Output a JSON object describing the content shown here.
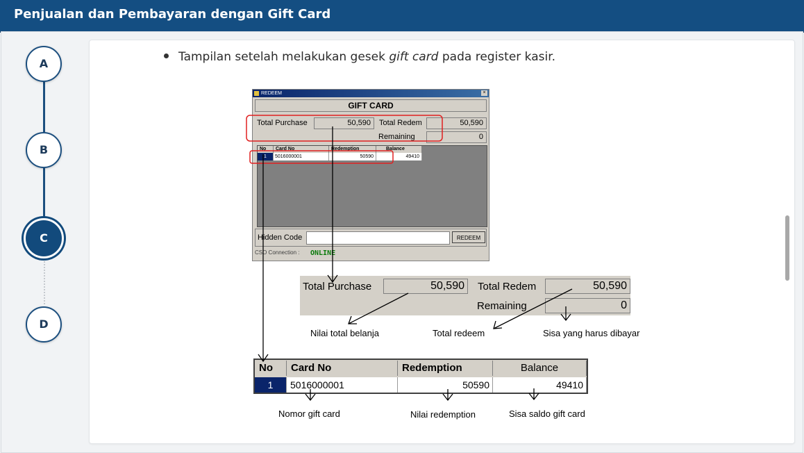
{
  "header": {
    "title": "Penjualan dan Pembayaran dengan Gift Card"
  },
  "steps": [
    "A",
    "B",
    "C",
    "D"
  ],
  "active_step": "C",
  "content": {
    "bullet_before": "Tampilan setelah melakukan gesek ",
    "bullet_italic": "gift card",
    "bullet_after": " pada register kasir."
  },
  "window": {
    "title": "REDEEM",
    "close": "×",
    "heading": "GIFT CARD",
    "total_purchase_label": "Total Purchase",
    "total_purchase": "50,590",
    "total_redem_label": "Total Redem",
    "total_redem": "50,590",
    "remaining_label": "Remaining",
    "remaining": "0",
    "columns": [
      "No",
      "Card No",
      "Redemption",
      "Balance"
    ],
    "row": {
      "no": "1",
      "card_no": "5016000001",
      "redemption": "50590",
      "balance": "49410"
    },
    "hidden_code_label": "Hidden Code",
    "redeem_button": "REDEEM",
    "connection_label": "CSO Connection :",
    "connection_status": "ONLINE"
  },
  "annotations": {
    "total_belanja": "Nilai total belanja",
    "total_redeem": "Total redeem",
    "sisa": "Sisa yang harus dibayar",
    "nomor": "Nomor gift card",
    "nilai_redemption": "Nilai redemption",
    "sisa_saldo": "Sisa saldo gift card"
  }
}
